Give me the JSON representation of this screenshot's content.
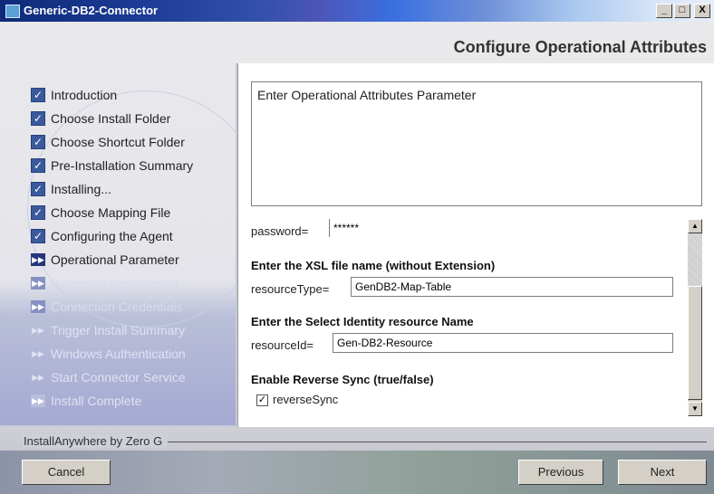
{
  "window": {
    "title": "Generic-DB2-Connector",
    "controls": {
      "minimize": "_",
      "maximize": "□",
      "close": "X"
    }
  },
  "header": {
    "title": "Configure Operational Attributes"
  },
  "steps": [
    {
      "label": "Introduction",
      "state": "done"
    },
    {
      "label": "Choose Install Folder",
      "state": "done"
    },
    {
      "label": "Choose Shortcut Folder",
      "state": "done"
    },
    {
      "label": "Pre-Installation Summary",
      "state": "done"
    },
    {
      "label": "Installing...",
      "state": "done"
    },
    {
      "label": "Choose Mapping File",
      "state": "done"
    },
    {
      "label": "Configuring the Agent",
      "state": "done"
    },
    {
      "label": "Operational Parameter",
      "state": "current"
    },
    {
      "label": "Reverse Trigger Install",
      "state": "pending"
    },
    {
      "label": "Connection Credentials",
      "state": "pending"
    },
    {
      "label": "Trigger Install Summary",
      "state": "pending"
    },
    {
      "label": "Windows Authentication",
      "state": "pending"
    },
    {
      "label": "Start Connector Service",
      "state": "pending"
    },
    {
      "label": "Install Complete",
      "state": "pending"
    }
  ],
  "intro": {
    "text": "Enter  Operational Attributes Parameter"
  },
  "form": {
    "password_label": "password=",
    "password_value": "******",
    "xsl_title": "Enter the XSL file name (without Extension)",
    "resourceType_label": "resourceType=",
    "resourceType_value": "GenDB2-Map-Table",
    "resource_title": "Enter the Select Identity resource Name",
    "resourceId_label": "resourceId=",
    "resourceId_value": "Gen-DB2-Resource",
    "reverse_title": "Enable Reverse Sync (true/false)",
    "reverseSync_label": "reverseSync",
    "reverseSync_checked": true
  },
  "footer": {
    "vendor": "InstallAnywhere by Zero G",
    "cancel": "Cancel",
    "previous": "Previous",
    "next": "Next"
  }
}
